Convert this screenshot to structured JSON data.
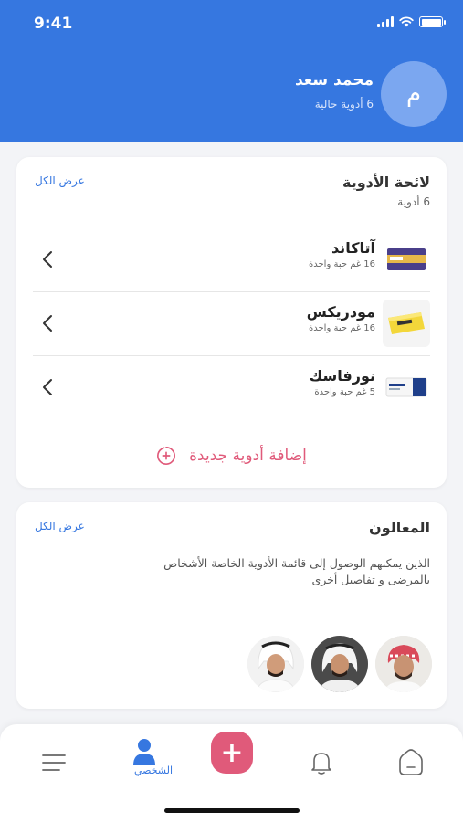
{
  "status": {
    "time": "9:41"
  },
  "user": {
    "initial": "م",
    "name": "محمد سعد",
    "subtitle": "6 أدوية حالية"
  },
  "medications_card": {
    "title": "لائحة الأدوية",
    "count": "6 أدوية",
    "view_all": "عرض الكل",
    "items": [
      {
        "name": "آتاكاند",
        "dose": "16 غم حبة واحدة"
      },
      {
        "name": "مودريكس",
        "dose": "16 غم حبة واحدة"
      },
      {
        "name": "نورفاسك",
        "dose": "5 غم حبة واحدة"
      }
    ],
    "add_label": "إضافة أدوية جديدة"
  },
  "caregivers_card": {
    "title": "المعالون",
    "view_all": "عرض الكل",
    "description": "الذين يمكنهم الوصول إلى قائمة الأدوية الخاصة الأشخاص بالمرضى و تفاصيل أخرى"
  },
  "tabbar": {
    "profile_label": "الشخصي",
    "fab_symbol": "+"
  },
  "colors": {
    "primary": "#3677e0",
    "accent": "#e05a7a",
    "background": "#f3f4f7"
  },
  "icons": [
    "signal-icon",
    "wifi-icon",
    "battery-icon",
    "chevron-left-icon",
    "add-circle-icon",
    "menu-icon",
    "profile-icon",
    "bell-icon",
    "home-icon"
  ]
}
